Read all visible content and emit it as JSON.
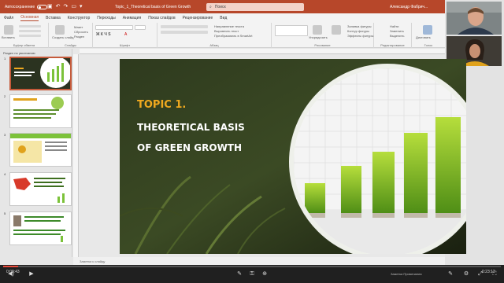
{
  "titlebar": {
    "autosave": "Автосохранение",
    "document": "Topic_1_Theoretical basis of Green Growth",
    "search_placeholder": "Поиск",
    "user": "Александр Фабрич...",
    "accent": "#b7472a"
  },
  "tabs": [
    "Файл",
    "Основная",
    "Вставка",
    "Конструктор",
    "Переходы",
    "Анимация",
    "Показ слайдов",
    "Рецензирование",
    "Вид"
  ],
  "ribbon": {
    "groups": [
      "Буфер обмена",
      "Слайды",
      "Шрифт",
      "Абзац",
      "Рисование",
      "Редактирование",
      "Голос"
    ],
    "paste_label": "Вставить",
    "new_slide_label": "Создать слайд",
    "layout_label": "Макет",
    "reset_label": "Сбросить",
    "section_label": "Раздел",
    "arrange_label": "Упорядочить",
    "quick_styles_label": "Экспресс-стили",
    "find_label": "Найти",
    "replace_label": "Заменить",
    "select_label": "Выделить",
    "dictate_label": "Диктовать",
    "text_direction": "Направление текста",
    "align_text": "Выровнять текст",
    "smartart": "Преобразовать в SmartArt",
    "fill_label": "Заливка фигуры",
    "outline_label": "Контур фигуры",
    "effects_label": "Эффекты фигуры"
  },
  "left_panel": {
    "header": "Раздел по умолчанию",
    "slide_numbers": [
      "1",
      "2",
      "3",
      "4",
      "5"
    ],
    "selected": "1"
  },
  "slide": {
    "topic": "TOPIC 1.",
    "title_line1": "THEORETICAL BASIS",
    "title_line2": "OF GREEN GROWTH",
    "topic_color": "#f0a91f"
  },
  "notes_label": "Заметки к слайду",
  "player": {
    "current_time": "0:00:43",
    "total_time": "0:23:13",
    "progress": 0.03
  },
  "status_right": "Заметки  Примечания"
}
